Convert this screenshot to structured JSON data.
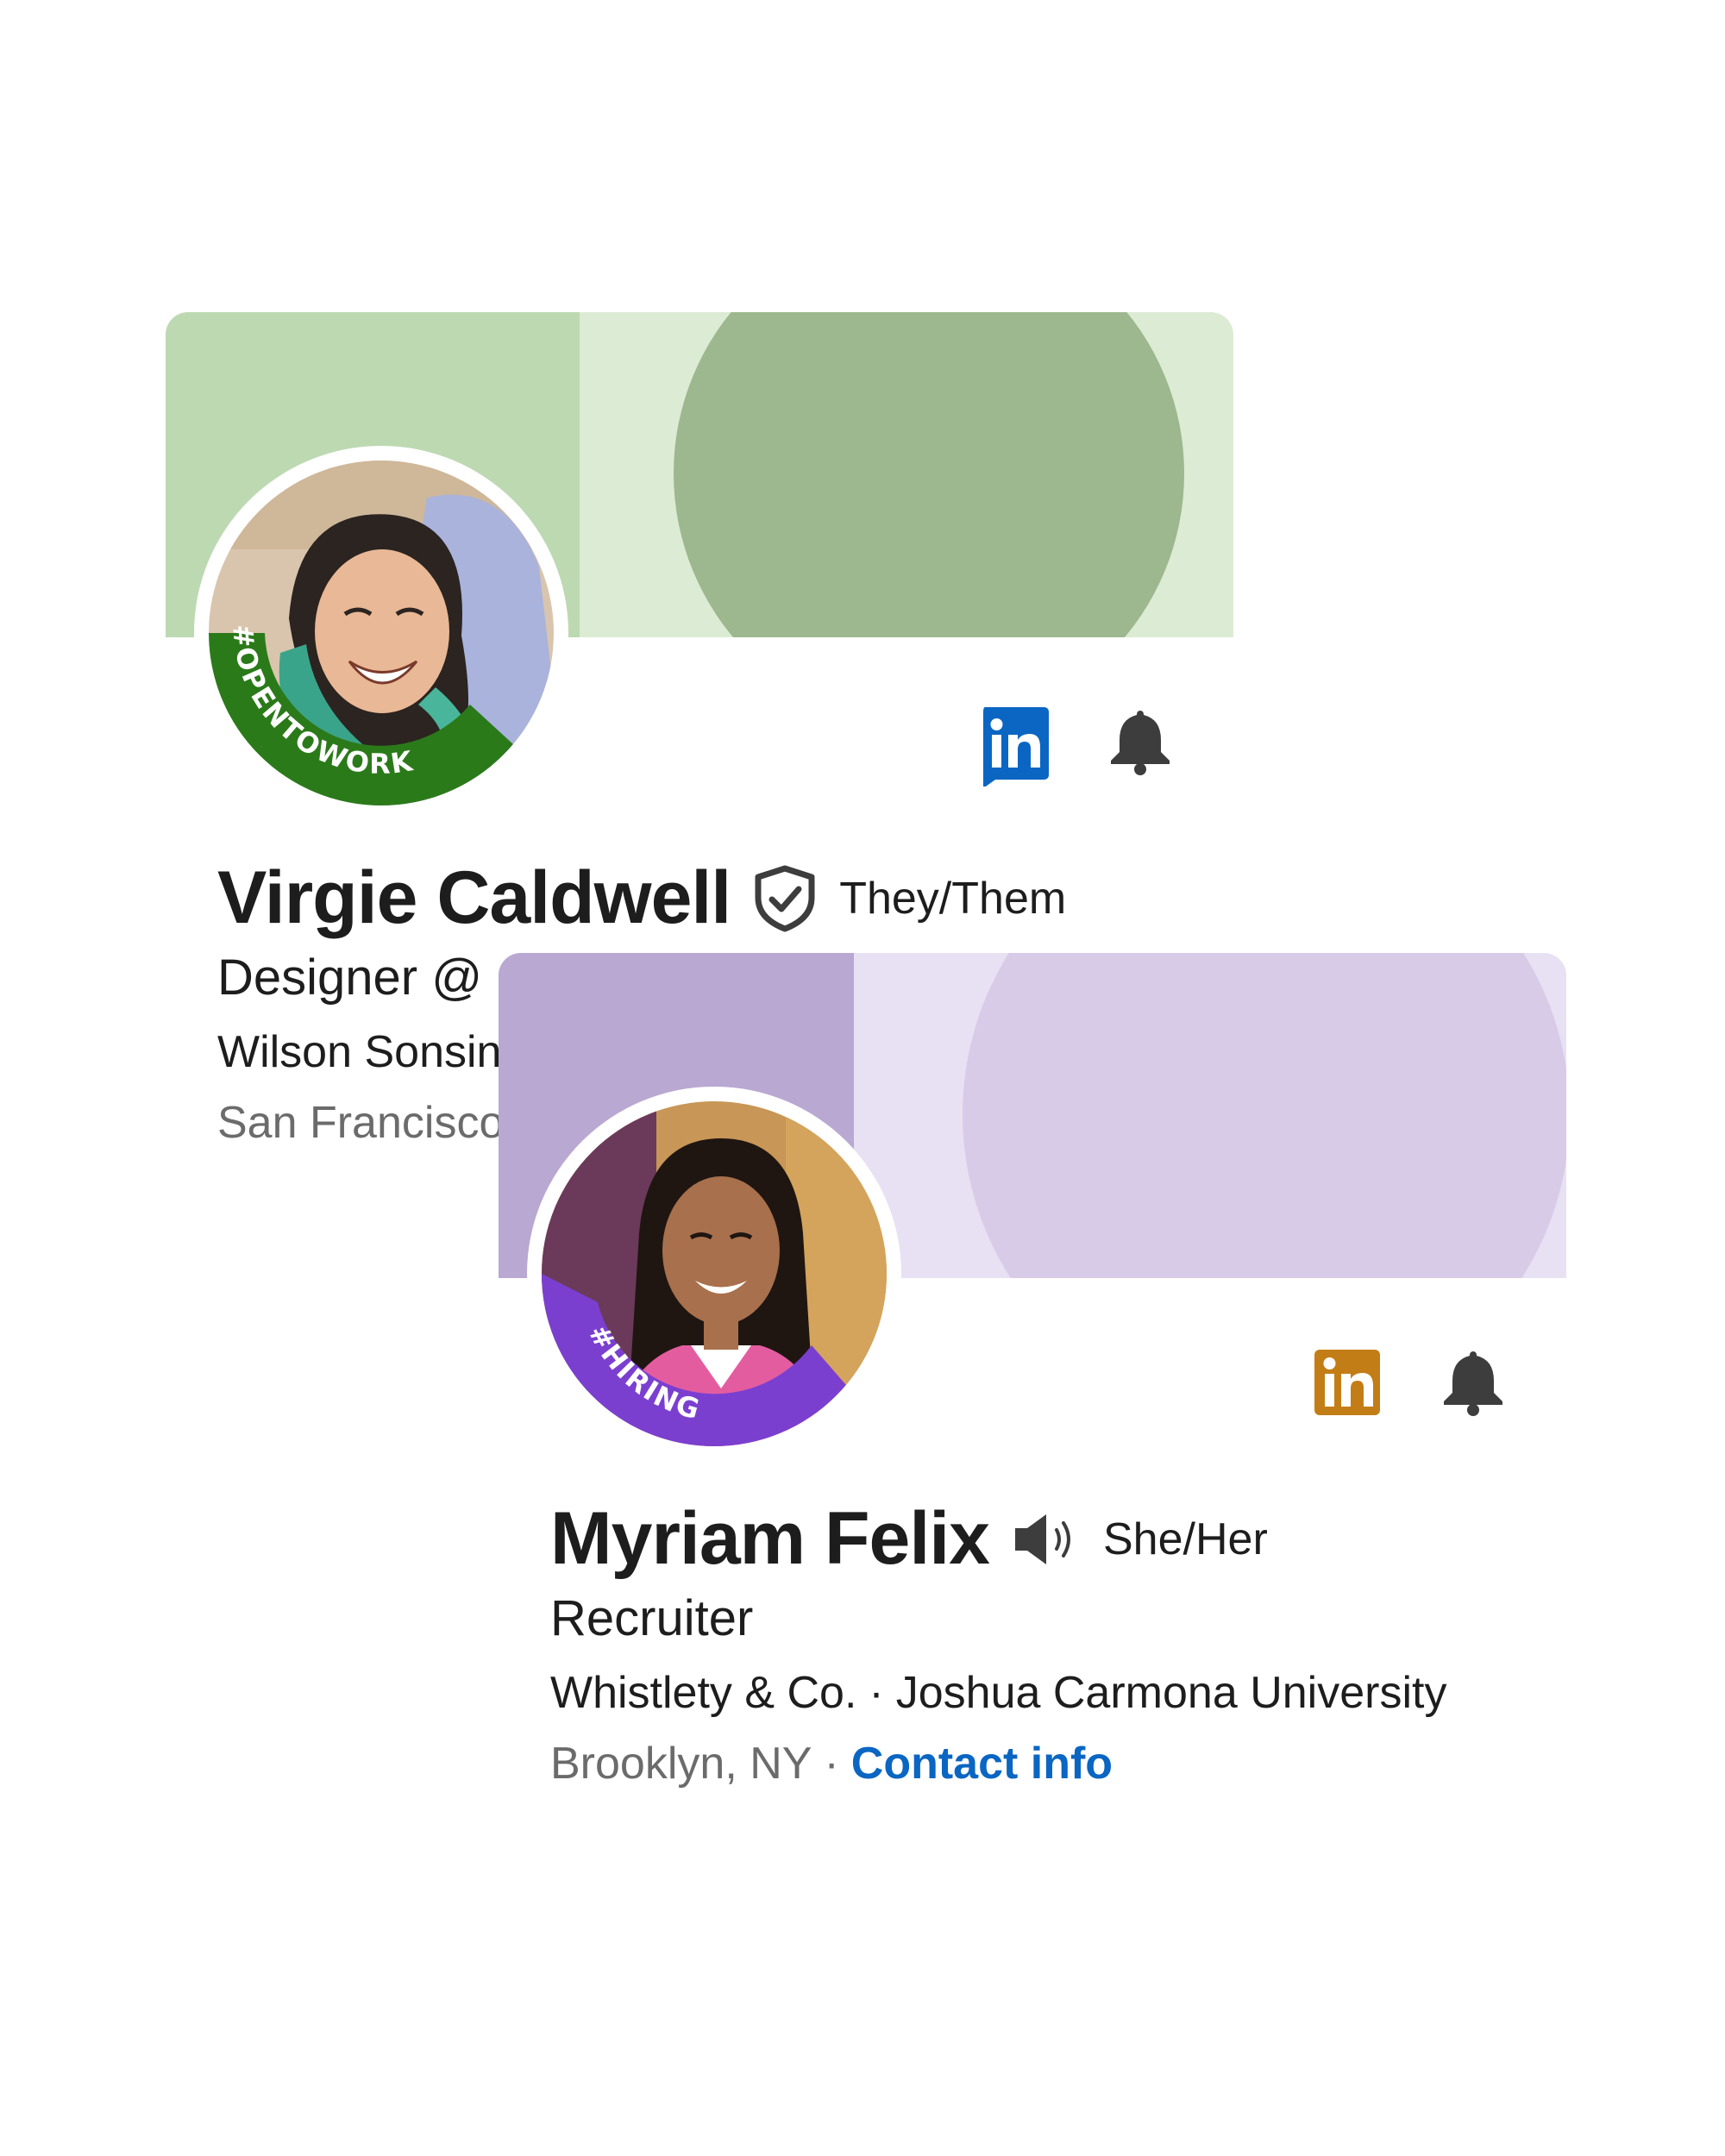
{
  "profiles": [
    {
      "name": "Virgie Caldwell",
      "pronouns": "They/Them",
      "headline": "Designer @ ",
      "org": "Wilson Sonsini",
      "location": "San Francisco",
      "frame_label": "#OPENTOWORK",
      "frame_color": "#2b7a1a",
      "banner_colors": [
        "#bdd9b2",
        "#dcebd4",
        "#9db78e"
      ],
      "badge_icon": "verified-shield-icon",
      "logo_icon": "linkedin-icon",
      "logo_color": "#0a66c2"
    },
    {
      "name": "Myriam Felix",
      "pronouns": "She/Her",
      "headline": "Recruiter",
      "org": "Whistlety & Co.",
      "org_separator": "·",
      "school": "Joshua Carmona University",
      "location": "Brooklyn, NY",
      "location_separator": "·",
      "contact_label": "Contact info",
      "frame_label": "#HIRING",
      "frame_color": "#7b3fd0",
      "banner_colors": [
        "#b9a8d2",
        "#e8e0f3",
        "#d7cbe7"
      ],
      "badge_icon": "speaker-icon",
      "logo_icon": "linkedin-icon",
      "logo_color": "#c37d16"
    }
  ]
}
